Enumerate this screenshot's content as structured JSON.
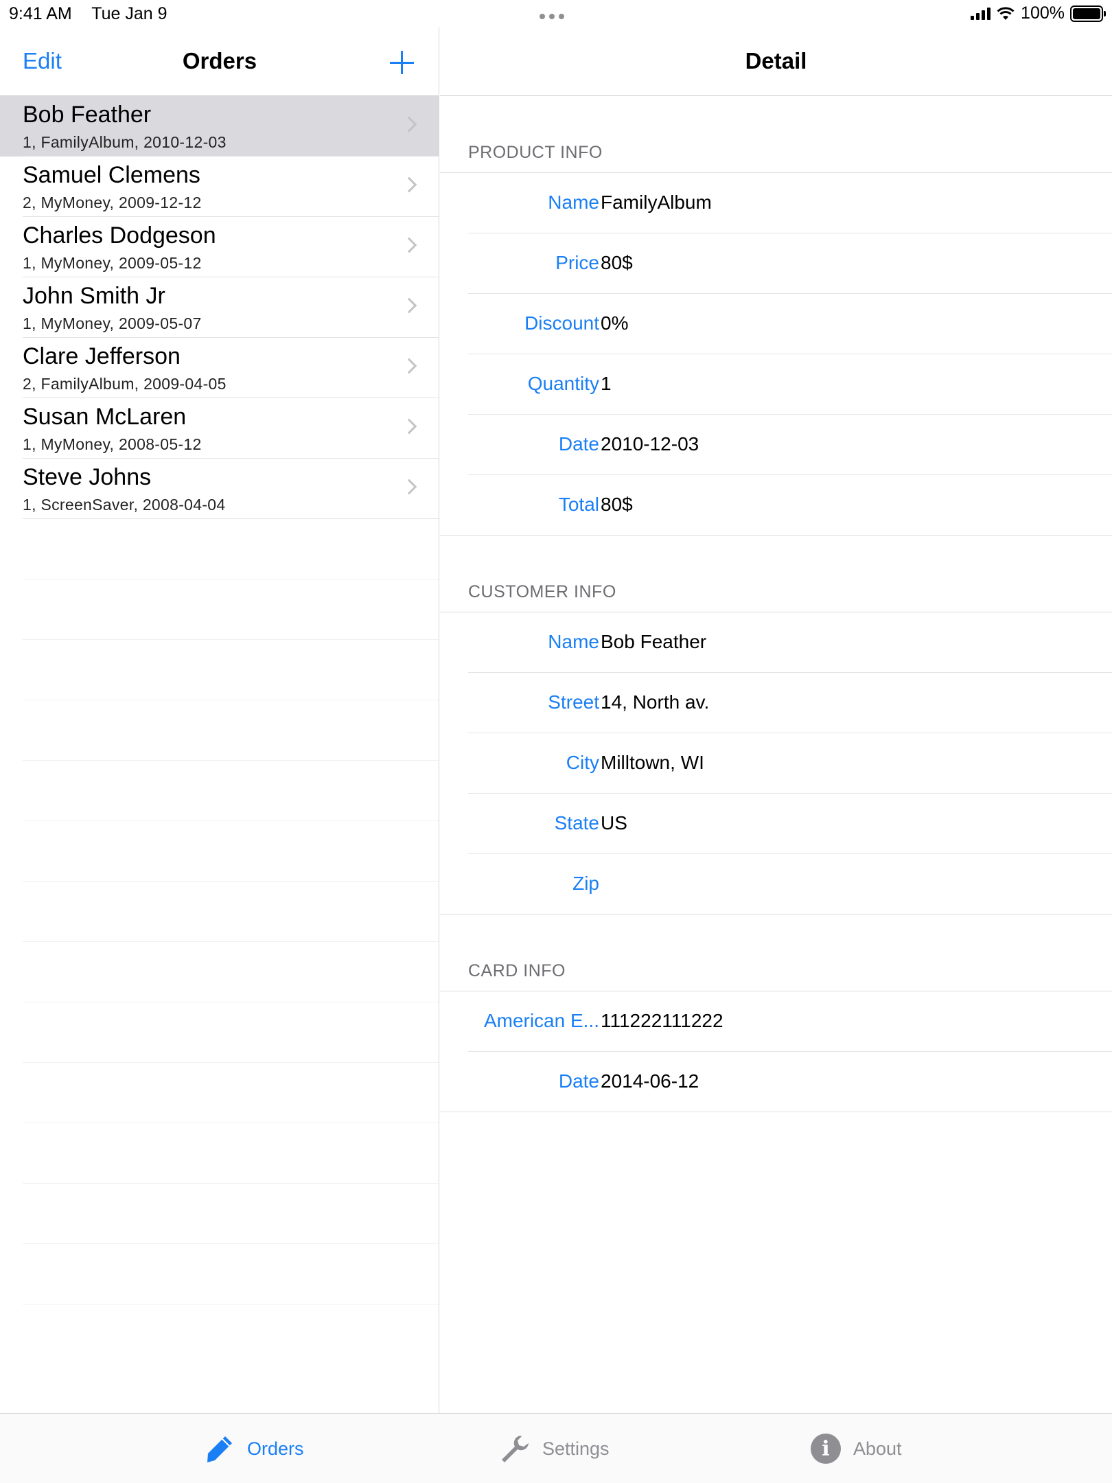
{
  "status_bar": {
    "time": "9:41 AM",
    "date": "Tue Jan 9",
    "battery": "100%",
    "battery_level": 1.0
  },
  "master": {
    "edit_label": "Edit",
    "title": "Orders",
    "add_icon": "plus-icon",
    "orders": [
      {
        "name": "Bob Feather",
        "subtitle": "1, FamilyAlbum, 2010-12-03",
        "selected": true
      },
      {
        "name": "Samuel Clemens",
        "subtitle": "2, MyMoney, 2009-12-12"
      },
      {
        "name": "Charles Dodgeson",
        "subtitle": "1, MyMoney, 2009-05-12"
      },
      {
        "name": "John Smith Jr",
        "subtitle": "1, MyMoney, 2009-05-07"
      },
      {
        "name": "Clare Jefferson",
        "subtitle": "2, FamilyAlbum, 2009-04-05"
      },
      {
        "name": "Susan McLaren",
        "subtitle": "1, MyMoney, 2008-05-12"
      },
      {
        "name": "Steve Johns",
        "subtitle": "1, ScreenSaver, 2008-04-04"
      }
    ]
  },
  "detail": {
    "title": "Detail",
    "sections": [
      {
        "header": "PRODUCT INFO",
        "rows": [
          {
            "label": "Name",
            "value": "FamilyAlbum"
          },
          {
            "label": "Price",
            "value": "80$"
          },
          {
            "label": "Discount",
            "value": "0%"
          },
          {
            "label": "Quantity",
            "value": "1"
          },
          {
            "label": "Date",
            "value": "2010-12-03"
          },
          {
            "label": "Total",
            "value": "80$"
          }
        ]
      },
      {
        "header": "CUSTOMER INFO",
        "rows": [
          {
            "label": "Name",
            "value": "Bob Feather"
          },
          {
            "label": "Street",
            "value": "14, North av."
          },
          {
            "label": "City",
            "value": "Milltown, WI"
          },
          {
            "label": "State",
            "value": "US"
          },
          {
            "label": "Zip",
            "value": ""
          }
        ]
      },
      {
        "header": "CARD INFO",
        "rows": [
          {
            "label": "American E...",
            "value": "111222111222"
          },
          {
            "label": "Date",
            "value": "2014-06-12"
          }
        ]
      }
    ]
  },
  "tab_bar": {
    "tabs": [
      {
        "label": "Orders",
        "icon": "pencil-icon",
        "active": true
      },
      {
        "label": "Settings",
        "icon": "wrench-icon",
        "active": false
      },
      {
        "label": "About",
        "icon": "info-icon",
        "active": false
      }
    ]
  },
  "colors": {
    "accent": "#1a7ff5",
    "selected_row": "#d9d9de",
    "inactive_tab": "#8e8e93"
  }
}
